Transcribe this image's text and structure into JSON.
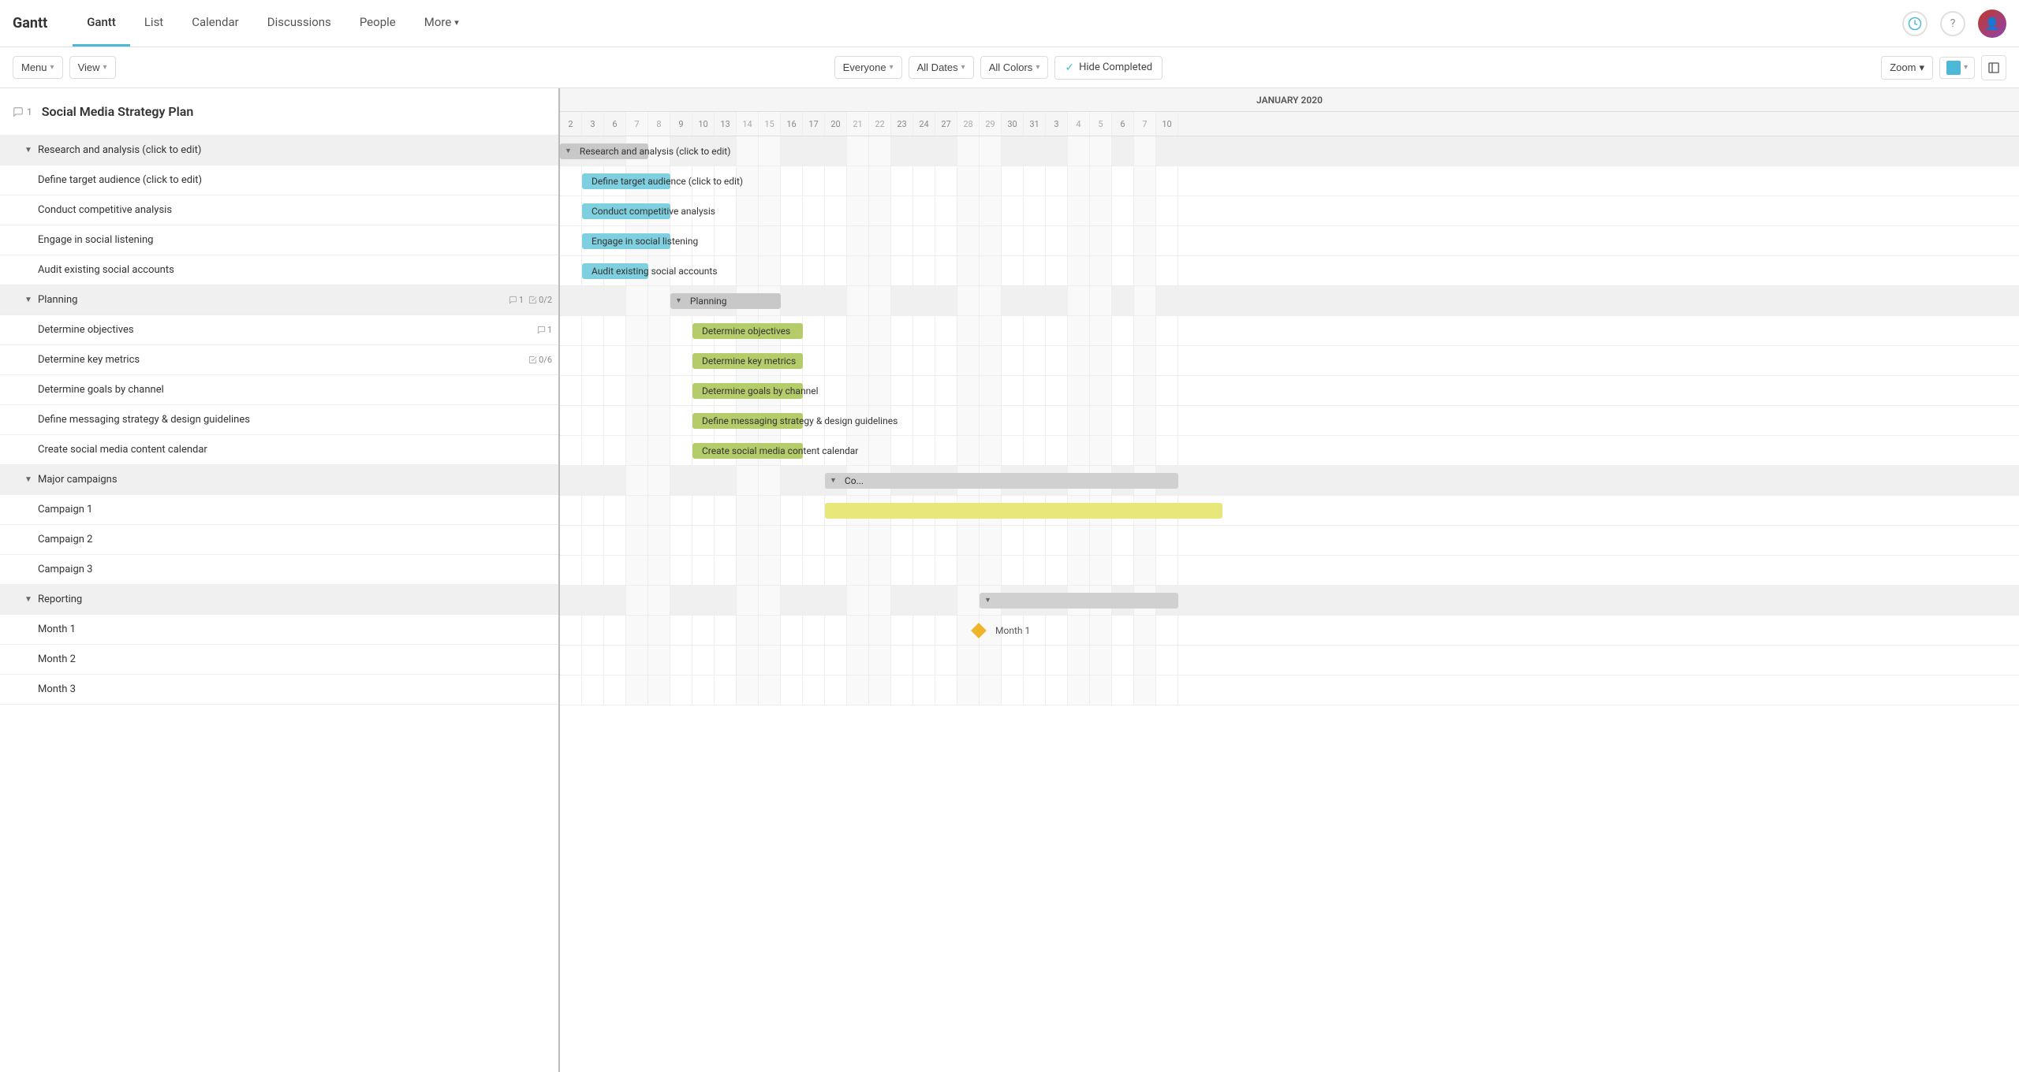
{
  "nav": {
    "logo": "Gantt",
    "tabs": [
      {
        "id": "gantt",
        "label": "Gantt",
        "active": true
      },
      {
        "id": "list",
        "label": "List",
        "active": false
      },
      {
        "id": "calendar",
        "label": "Calendar",
        "active": false
      },
      {
        "id": "discussions",
        "label": "Discussions",
        "active": false
      },
      {
        "id": "people",
        "label": "People",
        "active": false
      },
      {
        "id": "more",
        "label": "More",
        "active": false,
        "hasChevron": true
      }
    ]
  },
  "toolbar": {
    "menu_label": "Menu",
    "view_label": "View",
    "everyone_label": "Everyone",
    "all_dates_label": "All Dates",
    "all_colors_label": "All Colors",
    "hide_completed_label": "Hide Completed",
    "zoom_label": "Zoom"
  },
  "project": {
    "title": "Social Media Strategy Plan",
    "comment_count": "1"
  },
  "month_label": "JANUARY 2020",
  "days": [
    2,
    3,
    6,
    7,
    8,
    9,
    10,
    13,
    14,
    15,
    16,
    17,
    20,
    21,
    22,
    23,
    24,
    27,
    28,
    29,
    30,
    31,
    3,
    4,
    5,
    6,
    7,
    10
  ],
  "tasks": [
    {
      "id": "research",
      "name": "Research and analysis (click to edit)",
      "level": 1,
      "isGroup": true,
      "toggle": "▼",
      "bar": {
        "type": "gray",
        "start": 0,
        "width": 4,
        "label": "Research and analysis (click to edit)"
      }
    },
    {
      "id": "define-target",
      "name": "Define target audience (click to edit)",
      "level": 2,
      "isGroup": false,
      "bar": {
        "type": "blue",
        "start": 1,
        "width": 4,
        "label": "Define target audience (click to edit)"
      }
    },
    {
      "id": "competitive",
      "name": "Conduct competitive analysis",
      "level": 2,
      "isGroup": false,
      "bar": {
        "type": "blue",
        "start": 1,
        "width": 4,
        "label": "Conduct competitive analysis"
      }
    },
    {
      "id": "social-listening",
      "name": "Engage in social listening",
      "level": 2,
      "isGroup": false,
      "bar": {
        "type": "blue",
        "start": 1,
        "width": 4,
        "label": "Engage in social listening"
      }
    },
    {
      "id": "audit",
      "name": "Audit existing social accounts",
      "level": 2,
      "isGroup": false,
      "bar": {
        "type": "blue",
        "start": 1,
        "width": 3,
        "label": "Audit existing social accounts"
      }
    },
    {
      "id": "planning",
      "name": "Planning",
      "level": 1,
      "isGroup": true,
      "toggle": "▼",
      "comment_count": "1",
      "subtask_count": "0/2",
      "bar": {
        "type": "gray",
        "start": 5,
        "width": 5,
        "label": "Planning"
      }
    },
    {
      "id": "objectives",
      "name": "Determine objectives",
      "level": 2,
      "isGroup": false,
      "comment_count": "1",
      "bar": {
        "type": "green",
        "start": 6,
        "width": 5,
        "label": "Determine objectives"
      }
    },
    {
      "id": "key-metrics",
      "name": "Determine key metrics",
      "level": 2,
      "isGroup": false,
      "subtask_count": "0/6",
      "bar": {
        "type": "green",
        "start": 6,
        "width": 5,
        "label": "Determine key metrics"
      }
    },
    {
      "id": "goals-channel",
      "name": "Determine goals by channel",
      "level": 2,
      "isGroup": false,
      "bar": {
        "type": "green",
        "start": 6,
        "width": 5,
        "label": "Determine goals by channel"
      }
    },
    {
      "id": "messaging",
      "name": "Define messaging strategy & design guidelines",
      "level": 2,
      "isGroup": false,
      "bar": {
        "type": "green",
        "start": 6,
        "width": 5,
        "label": "Define messaging strategy & design guidelines"
      }
    },
    {
      "id": "content-calendar",
      "name": "Create social media content calendar",
      "level": 2,
      "isGroup": false,
      "bar": {
        "type": "green",
        "start": 6,
        "width": 5,
        "label": "Create social media content calendar"
      }
    },
    {
      "id": "campaigns",
      "name": "Major campaigns",
      "level": 1,
      "isGroup": true,
      "toggle": "▼",
      "bar": {
        "type": "gray-light",
        "start": 12,
        "width": 16,
        "label": "Co..."
      }
    },
    {
      "id": "campaign1",
      "name": "Campaign 1",
      "level": 2,
      "isGroup": false,
      "bar": {
        "type": "yellow",
        "start": 12,
        "width": 18,
        "label": ""
      }
    },
    {
      "id": "campaign2",
      "name": "Campaign 2",
      "level": 2,
      "isGroup": false,
      "bar": null
    },
    {
      "id": "campaign3",
      "name": "Campaign 3",
      "level": 2,
      "isGroup": false,
      "bar": null
    },
    {
      "id": "reporting",
      "name": "Reporting",
      "level": 1,
      "isGroup": true,
      "toggle": "▼",
      "bar": {
        "type": "gray-light",
        "start": 19,
        "width": 9,
        "label": ""
      }
    },
    {
      "id": "month1",
      "name": "Month 1",
      "level": 2,
      "isGroup": false,
      "bar": {
        "type": "diamond",
        "start": 19,
        "width": 0,
        "label": "Month 1"
      }
    },
    {
      "id": "month2",
      "name": "Month 2",
      "level": 2,
      "isGroup": false,
      "bar": null
    },
    {
      "id": "month3",
      "name": "Month 3",
      "level": 2,
      "isGroup": false,
      "bar": null
    }
  ]
}
